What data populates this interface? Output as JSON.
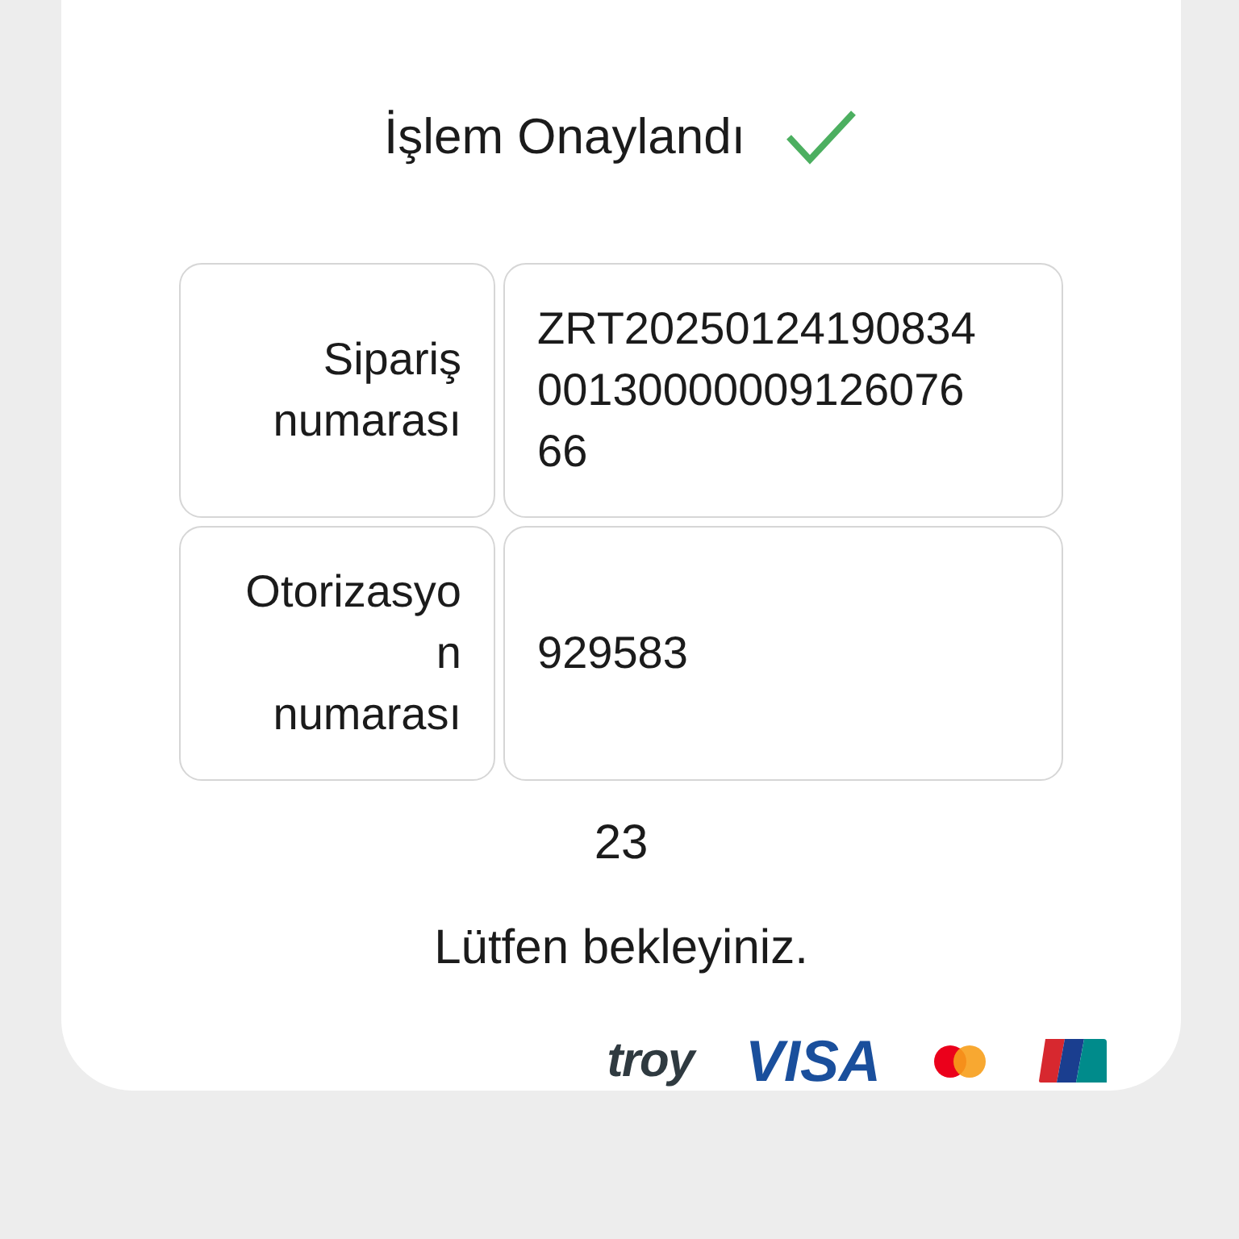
{
  "title": "İşlem Onaylandı",
  "table": [
    {
      "label": "Sipariş numarası",
      "value": "ZRT202501241908340013000000912607666"
    },
    {
      "label": "Otorizasyon numarası",
      "value": "929583"
    }
  ],
  "countdown": "23",
  "message": "Lütfen bekleyiniz.",
  "card_logos": [
    {
      "kind": "troy",
      "text": "troy"
    },
    {
      "kind": "visa",
      "text": "VISA"
    },
    {
      "kind": "mastercard"
    },
    {
      "kind": "unionpay"
    }
  ]
}
